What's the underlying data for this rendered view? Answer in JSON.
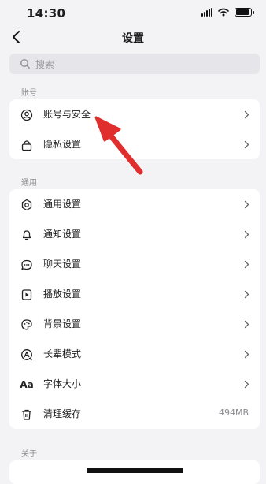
{
  "status_bar": {
    "time": "14:30"
  },
  "nav": {
    "title": "设置",
    "back": "back"
  },
  "search": {
    "placeholder": "搜索"
  },
  "sections": {
    "account": {
      "label": "账号",
      "items": [
        {
          "label": "账号与安全",
          "icon": "account-circle-icon"
        },
        {
          "label": "隐私设置",
          "icon": "lock-icon"
        }
      ]
    },
    "general": {
      "label": "通用",
      "items": [
        {
          "label": "通用设置",
          "icon": "gear-icon"
        },
        {
          "label": "通知设置",
          "icon": "bell-icon"
        },
        {
          "label": "聊天设置",
          "icon": "chat-bubble-icon"
        },
        {
          "label": "播放设置",
          "icon": "play-icon"
        },
        {
          "label": "背景设置",
          "icon": "palette-icon"
        },
        {
          "label": "长辈模式",
          "icon": "elder-mode-icon"
        },
        {
          "label": "字体大小",
          "icon": "font-size-icon",
          "glyph": "Aa"
        },
        {
          "label": "清理缓存",
          "icon": "trash-icon",
          "value": "494MB"
        }
      ]
    },
    "about": {
      "label": "关于"
    }
  },
  "colors": {
    "annotation_arrow": "#e02d2d",
    "page_bg": "#f3f3f5",
    "card_bg": "#ffffff"
  }
}
